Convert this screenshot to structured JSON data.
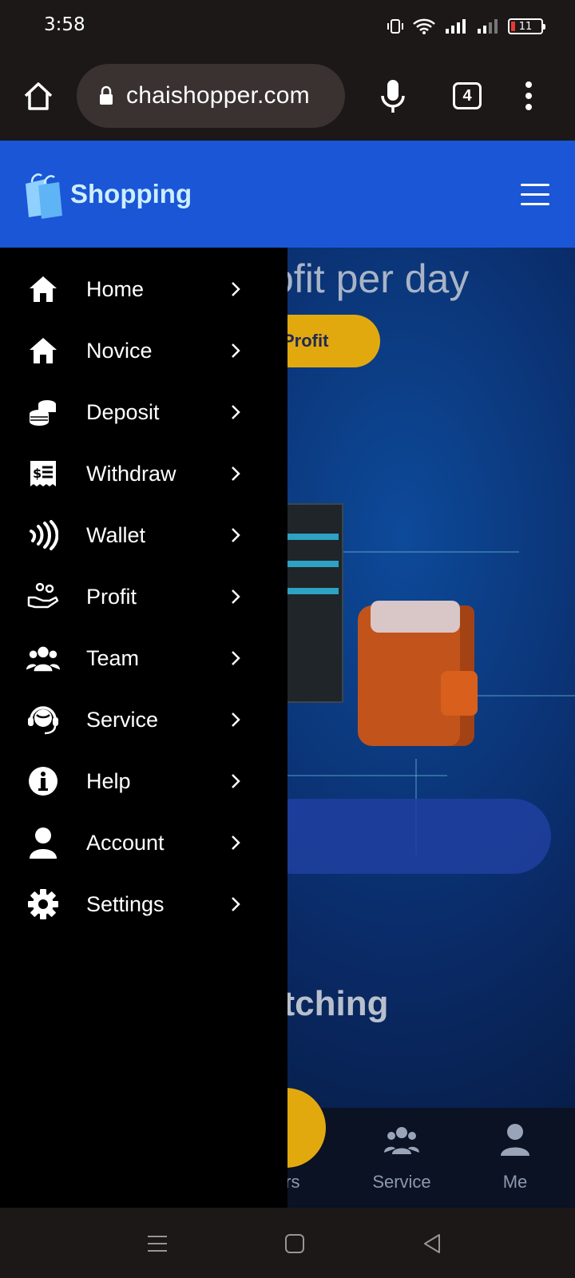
{
  "status_bar": {
    "time": "3:58",
    "battery": "11"
  },
  "browser": {
    "url": "chaishopper.com",
    "tab_count": "4"
  },
  "site": {
    "logo_text": "Shopping"
  },
  "background": {
    "hero_text": "ofit per day",
    "hero_button": "Profit",
    "section_text": "atching",
    "bottom_nav": {
      "left_partial": "lers",
      "service": "Service",
      "me": "Me"
    }
  },
  "drawer": {
    "items": [
      {
        "label": "Home",
        "icon": "home-icon"
      },
      {
        "label": "Novice",
        "icon": "home-icon"
      },
      {
        "label": "Deposit",
        "icon": "coins-icon"
      },
      {
        "label": "Withdraw",
        "icon": "receipt-icon"
      },
      {
        "label": "Wallet",
        "icon": "contactless-icon"
      },
      {
        "label": "Profit",
        "icon": "hand-holding-icon"
      },
      {
        "label": "Team",
        "icon": "users-icon"
      },
      {
        "label": "Service",
        "icon": "headset-icon"
      },
      {
        "label": "Help",
        "icon": "info-icon"
      },
      {
        "label": "Account",
        "icon": "user-icon"
      },
      {
        "label": "Settings",
        "icon": "gear-icon"
      }
    ]
  },
  "colors": {
    "header": "#1a56d6",
    "drawer": "#000000",
    "accent": "#e2a90f"
  }
}
